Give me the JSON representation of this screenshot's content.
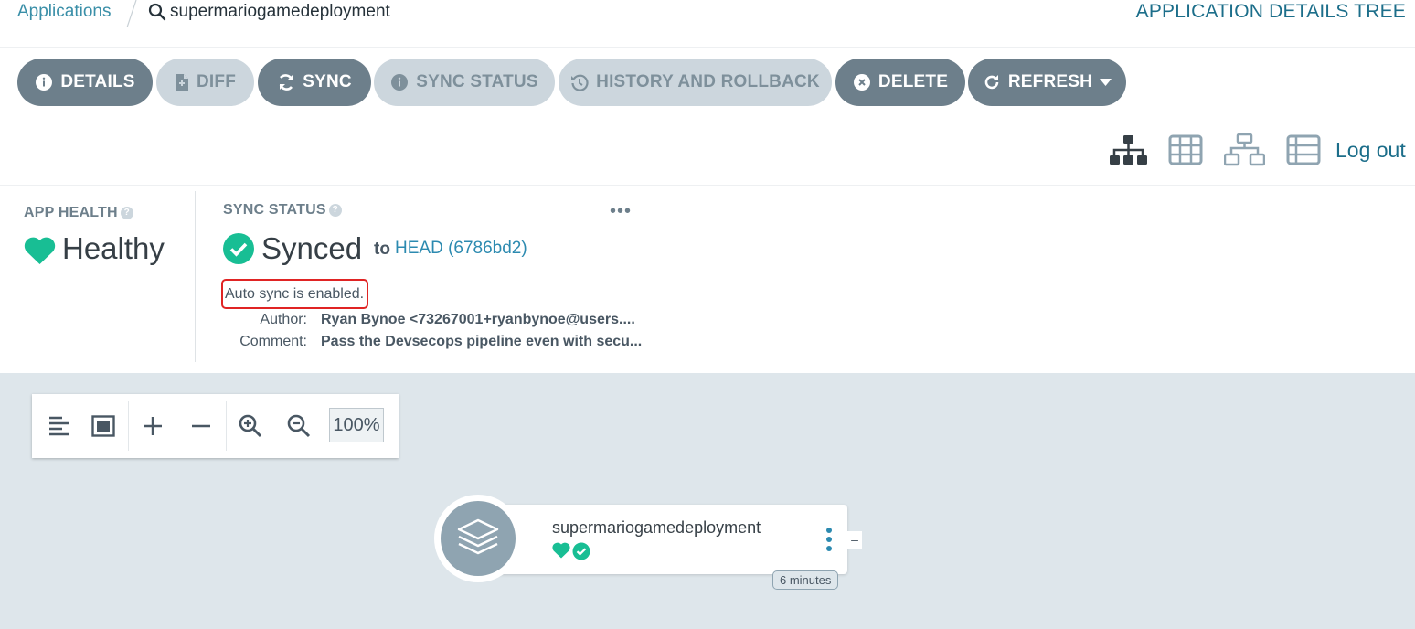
{
  "breadcrumb": {
    "root": "Applications",
    "app_name": "supermariogamedeployment"
  },
  "page_title": "APPLICATION DETAILS TREE",
  "toolbar": {
    "details": "DETAILS",
    "diff": "DIFF",
    "sync": "SYNC",
    "sync_status": "SYNC STATUS",
    "history": "HISTORY AND ROLLBACK",
    "delete": "DELETE",
    "refresh": "REFRESH"
  },
  "view_icons": [
    "tree-view-icon",
    "pods-grid-view-icon",
    "network-view-icon",
    "list-view-icon"
  ],
  "logout": "Log out",
  "app_health": {
    "label": "APP HEALTH",
    "value": "Healthy"
  },
  "sync_status": {
    "label": "SYNC STATUS",
    "value": "Synced",
    "to": "to",
    "revision": "HEAD (6786bd2)",
    "auto_sync": "Auto sync is enabled.",
    "author_label": "Author:",
    "author": "Ryan Bynoe <73267001+ryanbynoe@users....",
    "comment_label": "Comment:",
    "comment": "Pass the Devsecops pipeline even with secu..."
  },
  "graph_tools": {
    "zoom": "100%"
  },
  "node": {
    "name": "supermariogamedeployment",
    "age": "6 minutes",
    "collapse": "–"
  },
  "colors": {
    "accent": "#1c6e8a",
    "healthy": "#18be94",
    "button_dark": "#6d7f8b",
    "button_light": "#ccd6dd",
    "graph_bg": "#dee6eb",
    "highlight": "#e02424"
  }
}
